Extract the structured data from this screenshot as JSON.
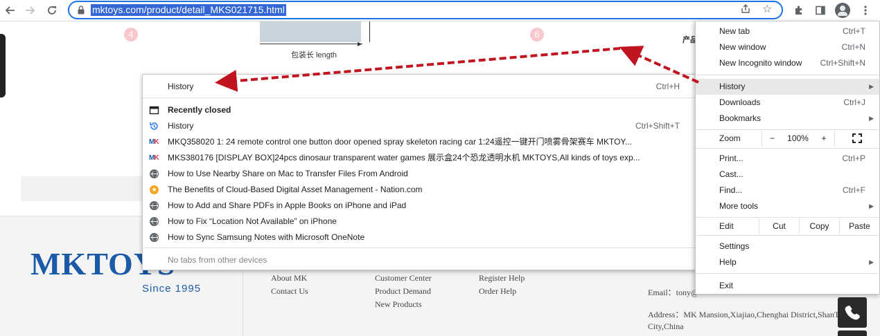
{
  "toolbar": {
    "url": "mktoys.com/product/detail_MKS021715.html"
  },
  "page": {
    "step_left": "4",
    "step_right": "6",
    "dimension_label": "包装长 length",
    "side_char": "产品"
  },
  "history_menu": {
    "header": {
      "label": "History",
      "shortcut": "Ctrl+H"
    },
    "recently_closed": "Recently closed",
    "history_item": {
      "label": "History",
      "shortcut": "Ctrl+Shift+T"
    },
    "items": [
      {
        "icon": "mk-favicon",
        "label": "MKQ358020 1: 24 remote control one button door opened spray skeleton racing car 1:24遥控一键开门喷雾骨架赛车 MKTOY..."
      },
      {
        "icon": "mk-favicon",
        "label": "MKS380176 [DISPLAY BOX]24pcs dinosaur transparent water games 展示盒24个恐龙透明水机 MKTOYS,All kinds of toys exp..."
      },
      {
        "icon": "globe-icon",
        "label": "How to Use Nearby Share on Mac to Transfer Files From Android"
      },
      {
        "icon": "star-favicon",
        "label": "The Benefits of Cloud-Based Digital Asset Management - Nation.com"
      },
      {
        "icon": "globe-icon",
        "label": "How to Add and Share PDFs in Apple Books on iPhone and iPad"
      },
      {
        "icon": "globe-icon",
        "label": "How to Fix “Location Not Available” on iPhone"
      },
      {
        "icon": "globe-icon",
        "label": "How to Sync Samsung Notes with Microsoft OneNote"
      }
    ],
    "no_tabs": "No tabs from other devices"
  },
  "chrome_menu": {
    "new_tab": {
      "label": "New tab",
      "shortcut": "Ctrl+T"
    },
    "new_window": {
      "label": "New window",
      "shortcut": "Ctrl+N"
    },
    "new_incognito": {
      "label": "New Incognito window",
      "shortcut": "Ctrl+Shift+N"
    },
    "history": {
      "label": "History"
    },
    "downloads": {
      "label": "Downloads",
      "shortcut": "Ctrl+J"
    },
    "bookmarks": {
      "label": "Bookmarks"
    },
    "zoom": {
      "label": "Zoom",
      "minus": "−",
      "value": "100%",
      "plus": "+"
    },
    "print": {
      "label": "Print...",
      "shortcut": "Ctrl+P"
    },
    "cast": {
      "label": "Cast..."
    },
    "find": {
      "label": "Find...",
      "shortcut": "Ctrl+F"
    },
    "more_tools": {
      "label": "More tools"
    },
    "edit": {
      "label": "Edit",
      "cut": "Cut",
      "copy": "Copy",
      "paste": "Paste"
    },
    "settings": {
      "label": "Settings"
    },
    "help": {
      "label": "Help"
    },
    "exit": {
      "label": "Exit"
    }
  },
  "footer": {
    "logo": "MKTOYS",
    "since": "Since 1995",
    "col1": [
      "About MK",
      "Contact Us"
    ],
    "col2": [
      "Customer Center",
      "Product Demand",
      "New Products"
    ],
    "col3": [
      "Register Help",
      "Order Help"
    ],
    "email": "Email：tony@",
    "address": "Address：MK Mansion,Xiajiao,Chenghai District,ShanT",
    "address2": "City,China"
  },
  "colors": {
    "accent": "#1a73e8",
    "url_highlight": "#3367d6",
    "arrow": "#c0141e",
    "brand_blue": "#1a5aa6",
    "brand_red": "#e5394a"
  }
}
